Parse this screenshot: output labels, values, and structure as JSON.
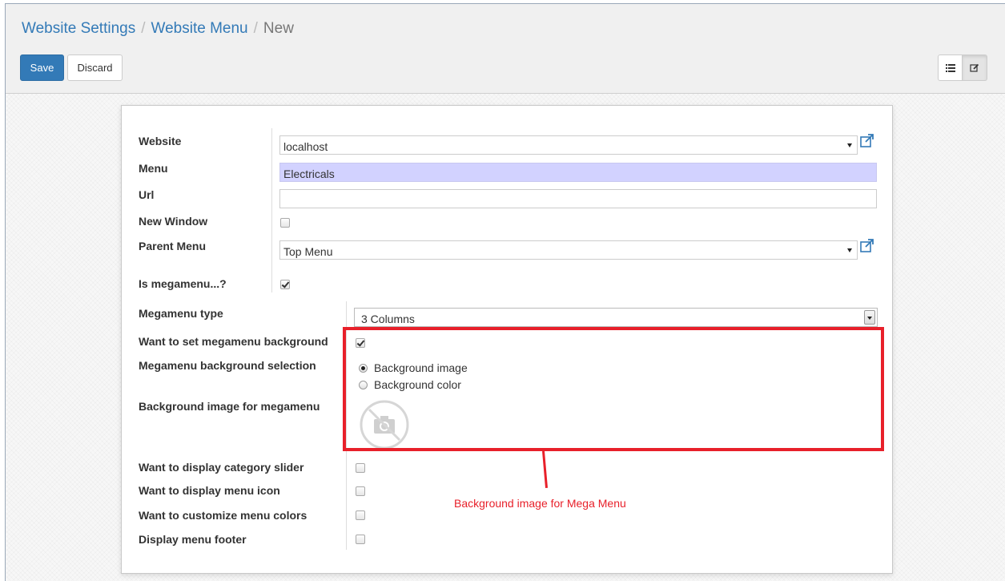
{
  "breadcrumb": {
    "items": [
      "Website Settings",
      "Website Menu"
    ],
    "current": "New",
    "separator": "/"
  },
  "toolbar": {
    "save_label": "Save",
    "discard_label": "Discard"
  },
  "view_switcher": {
    "icons": [
      "list-view-icon",
      "form-view-icon"
    ],
    "active": "form-view-icon"
  },
  "form": {
    "website": {
      "label": "Website",
      "value": "localhost"
    },
    "menu": {
      "label": "Menu",
      "value": "Electricals"
    },
    "url": {
      "label": "Url",
      "value": ""
    },
    "new_window": {
      "label": "New Window",
      "checked": false
    },
    "parent_menu": {
      "label": "Parent Menu",
      "value": "Top Menu"
    },
    "is_megamenu": {
      "label": "Is megamenu...?",
      "checked": true
    },
    "megamenu_type": {
      "label": "Megamenu type",
      "value": "3 Columns"
    },
    "megamenu_background": {
      "label": "Want to set megamenu background",
      "checked": true
    },
    "background_selection": {
      "label": "Megamenu background selection",
      "options": [
        "Background image",
        "Background color"
      ],
      "selected": "Background image"
    },
    "background_image": {
      "label": "Background image for megamenu",
      "placeholder_icon": "no-image-camera-icon"
    },
    "category_slider": {
      "label": "Want to display category slider",
      "checked": false
    },
    "menu_icon": {
      "label": "Want to display menu icon",
      "checked": false
    },
    "menu_colors": {
      "label": "Want to customize menu colors",
      "checked": false
    },
    "menu_footer": {
      "label": "Display menu footer",
      "checked": false
    }
  },
  "annotation": {
    "text": "Background image for Mega Menu",
    "color": "#e8202a"
  },
  "colors": {
    "primary": "#337ab7",
    "required_field": "#d2d2ff",
    "annotation_red": "#e8202a"
  }
}
